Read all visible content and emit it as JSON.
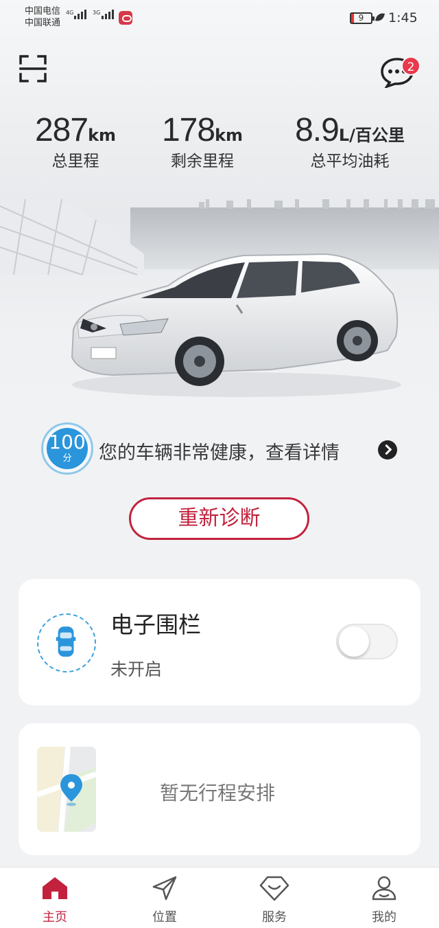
{
  "status_bar": {
    "carrier1": "中国电信",
    "carrier2": "中国联通",
    "net1": "4G",
    "net2": "3G",
    "battery": "9",
    "time": "1:45"
  },
  "header": {
    "message_badge": "2"
  },
  "stats": [
    {
      "value": "287",
      "unit": "km",
      "label": "总里程"
    },
    {
      "value": "178",
      "unit": "km",
      "label": "剩余里程"
    },
    {
      "value": "8.9",
      "unit": "L/百公里",
      "label": "总平均油耗"
    }
  ],
  "health": {
    "score": "100",
    "score_unit": "分",
    "text": "您的车辆非常健康，查看详情"
  },
  "rediagnose_label": "重新诊断",
  "fence_card": {
    "title": "电子围栏",
    "status": "未开启",
    "enabled": false
  },
  "trip_card": {
    "text": "暂无行程安排"
  },
  "tabs": [
    {
      "label": "主页",
      "icon": "home-icon",
      "active": true
    },
    {
      "label": "位置",
      "icon": "location-arrow-icon",
      "active": false
    },
    {
      "label": "服务",
      "icon": "service-icon",
      "active": false
    },
    {
      "label": "我的",
      "icon": "profile-icon",
      "active": false
    }
  ],
  "colors": {
    "accent": "#c2223d",
    "score_blue": "#2b95dc",
    "badge_red": "#e8394d"
  }
}
